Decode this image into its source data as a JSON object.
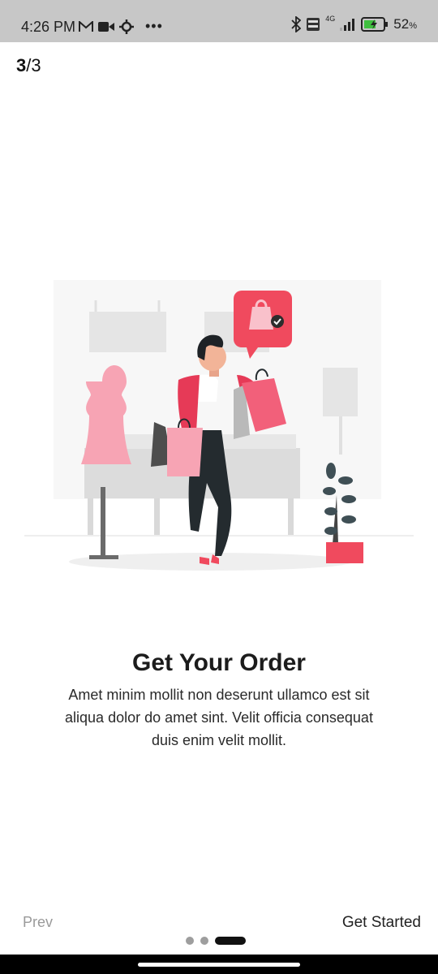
{
  "status_bar": {
    "time": "4:26 PM",
    "battery": "52",
    "battery_unit": "%",
    "network": "4G"
  },
  "pager": {
    "current": "3",
    "separator": "/",
    "total": "3"
  },
  "onboarding": {
    "title": "Get Your Order",
    "description": "Amet minim mollit non deserunt ullamco est sit aliqua dolor do amet sint. Velit officia consequat duis enim velit mollit."
  },
  "footer": {
    "prev_label": "Prev",
    "next_label": "Get Started",
    "dots": 3,
    "active_dot": 3
  },
  "colors": {
    "accent": "#f04a5e",
    "pink": "#f7a4b4",
    "gray": "#e6e6e6"
  }
}
